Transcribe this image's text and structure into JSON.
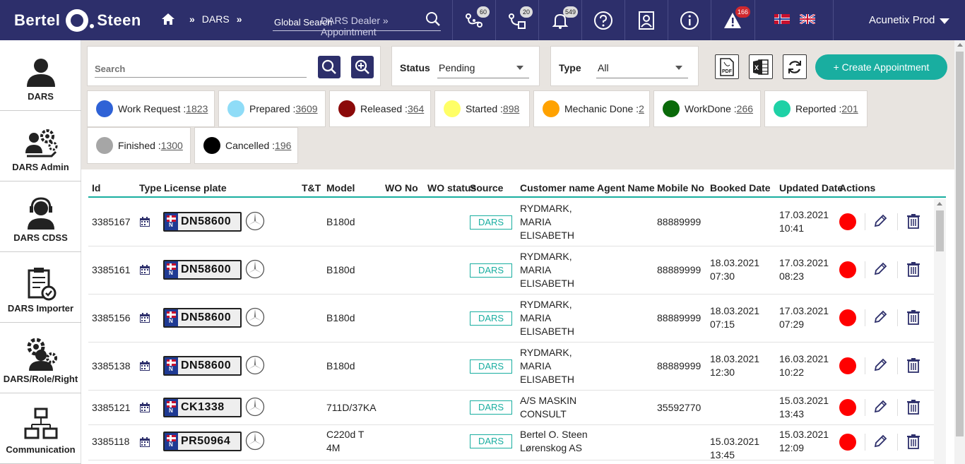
{
  "brand": {
    "left": "Bertel",
    "right": "Steen"
  },
  "breadcrumb": {
    "items": [
      "DARS",
      "DARS Dealer",
      "Appointment"
    ],
    "sep": "»"
  },
  "global_search": {
    "placeholder": "Global Search"
  },
  "topbar_badges": {
    "map1": "60",
    "map2": "20",
    "bell": "549",
    "alert": "166"
  },
  "user": {
    "name": "Acunetix Prod"
  },
  "sidebar": {
    "items": [
      {
        "label": "DARS",
        "icon": "person-icon"
      },
      {
        "label": "DARS Admin",
        "icon": "admin-gear-icon"
      },
      {
        "label": "DARS CDSS",
        "icon": "headset-icon"
      },
      {
        "label": "DARS Importer",
        "icon": "clipboard-check-icon"
      },
      {
        "label": "DARS/Role/Right",
        "icon": "role-gear-icon"
      },
      {
        "label": "Communication",
        "icon": "network-icon"
      }
    ]
  },
  "filters": {
    "search_label": "Search",
    "status_label": "Status",
    "status_value": "Pending",
    "type_label": "Type",
    "type_value": "All",
    "create_label": "+ Create Appointment"
  },
  "statuses": [
    {
      "label": "Work Request :",
      "count": "1823",
      "color": "#2f62d6"
    },
    {
      "label": "Prepared :",
      "count": "3609",
      "color": "#8fdcf7"
    },
    {
      "label": "Released :",
      "count": "364",
      "color": "#8b0a0a"
    },
    {
      "label": "Started :",
      "count": "898",
      "color": "#ffff66"
    },
    {
      "label": "Mechanic Done :",
      "count": "2",
      "color": "#ffa200"
    },
    {
      "label": "WorkDone :",
      "count": "266",
      "color": "#0a6a0a"
    },
    {
      "label": "Reported :",
      "count": "201",
      "color": "#1ed1a6"
    },
    {
      "label": "Finished :",
      "count": "1300",
      "color": "#a6a6a6"
    },
    {
      "label": "Cancelled :",
      "count": "196",
      "color": "#000000"
    }
  ],
  "table": {
    "columns": [
      "Id",
      "Type",
      "License plate",
      "T&T",
      "Model",
      "WO No",
      "WO status",
      "Source",
      "Customer name",
      "Agent Name",
      "Mobile No",
      "Booked Date",
      "Updated Date",
      "Actions"
    ],
    "rows": [
      {
        "id": "3385167",
        "plate": "DN58600",
        "model1": "B180d",
        "model2": "",
        "source": "DARS",
        "cust1": "RYDMARK,",
        "cust2": "MARIA",
        "cust3": "ELISABETH",
        "mobile": "88889999",
        "booked1": "",
        "booked2": "",
        "upd1": "17.03.2021",
        "upd2": "10:41"
      },
      {
        "id": "3385161",
        "plate": "DN58600",
        "model1": "B180d",
        "model2": "",
        "source": "DARS",
        "cust1": "RYDMARK,",
        "cust2": "MARIA",
        "cust3": "ELISABETH",
        "mobile": "88889999",
        "booked1": "18.03.2021",
        "booked2": "07:30",
        "upd1": "17.03.2021",
        "upd2": "08:23"
      },
      {
        "id": "3385156",
        "plate": "DN58600",
        "model1": "B180d",
        "model2": "",
        "source": "DARS",
        "cust1": "RYDMARK,",
        "cust2": "MARIA",
        "cust3": "ELISABETH",
        "mobile": "88889999",
        "booked1": "18.03.2021",
        "booked2": "07:15",
        "upd1": "17.03.2021",
        "upd2": "07:29"
      },
      {
        "id": "3385138",
        "plate": "DN58600",
        "model1": "B180d",
        "model2": "",
        "source": "DARS",
        "cust1": "RYDMARK,",
        "cust2": "MARIA",
        "cust3": "ELISABETH",
        "mobile": "88889999",
        "booked1": "18.03.2021",
        "booked2": "12:30",
        "upd1": "16.03.2021",
        "upd2": "10:22"
      },
      {
        "id": "3385121",
        "plate": "CK1338",
        "model1": "711D/37KA",
        "model2": "",
        "source": "DARS",
        "cust1": "A/S MASKIN",
        "cust2": "CONSULT",
        "cust3": "",
        "mobile": "35592770",
        "booked1": "",
        "booked2": "",
        "upd1": "15.03.2021",
        "upd2": "13:43"
      },
      {
        "id": "3385118",
        "plate": "PR50964",
        "model1": "C220d T",
        "model2": "4M",
        "source": "DARS",
        "cust1": "Bertel O. Steen",
        "cust2": "Lørenskog AS",
        "cust3": "",
        "mobile": "",
        "booked1": "15.03.2021",
        "booked2": "13:45",
        "upd1": "15.03.2021",
        "upd2": "12:09"
      }
    ]
  }
}
